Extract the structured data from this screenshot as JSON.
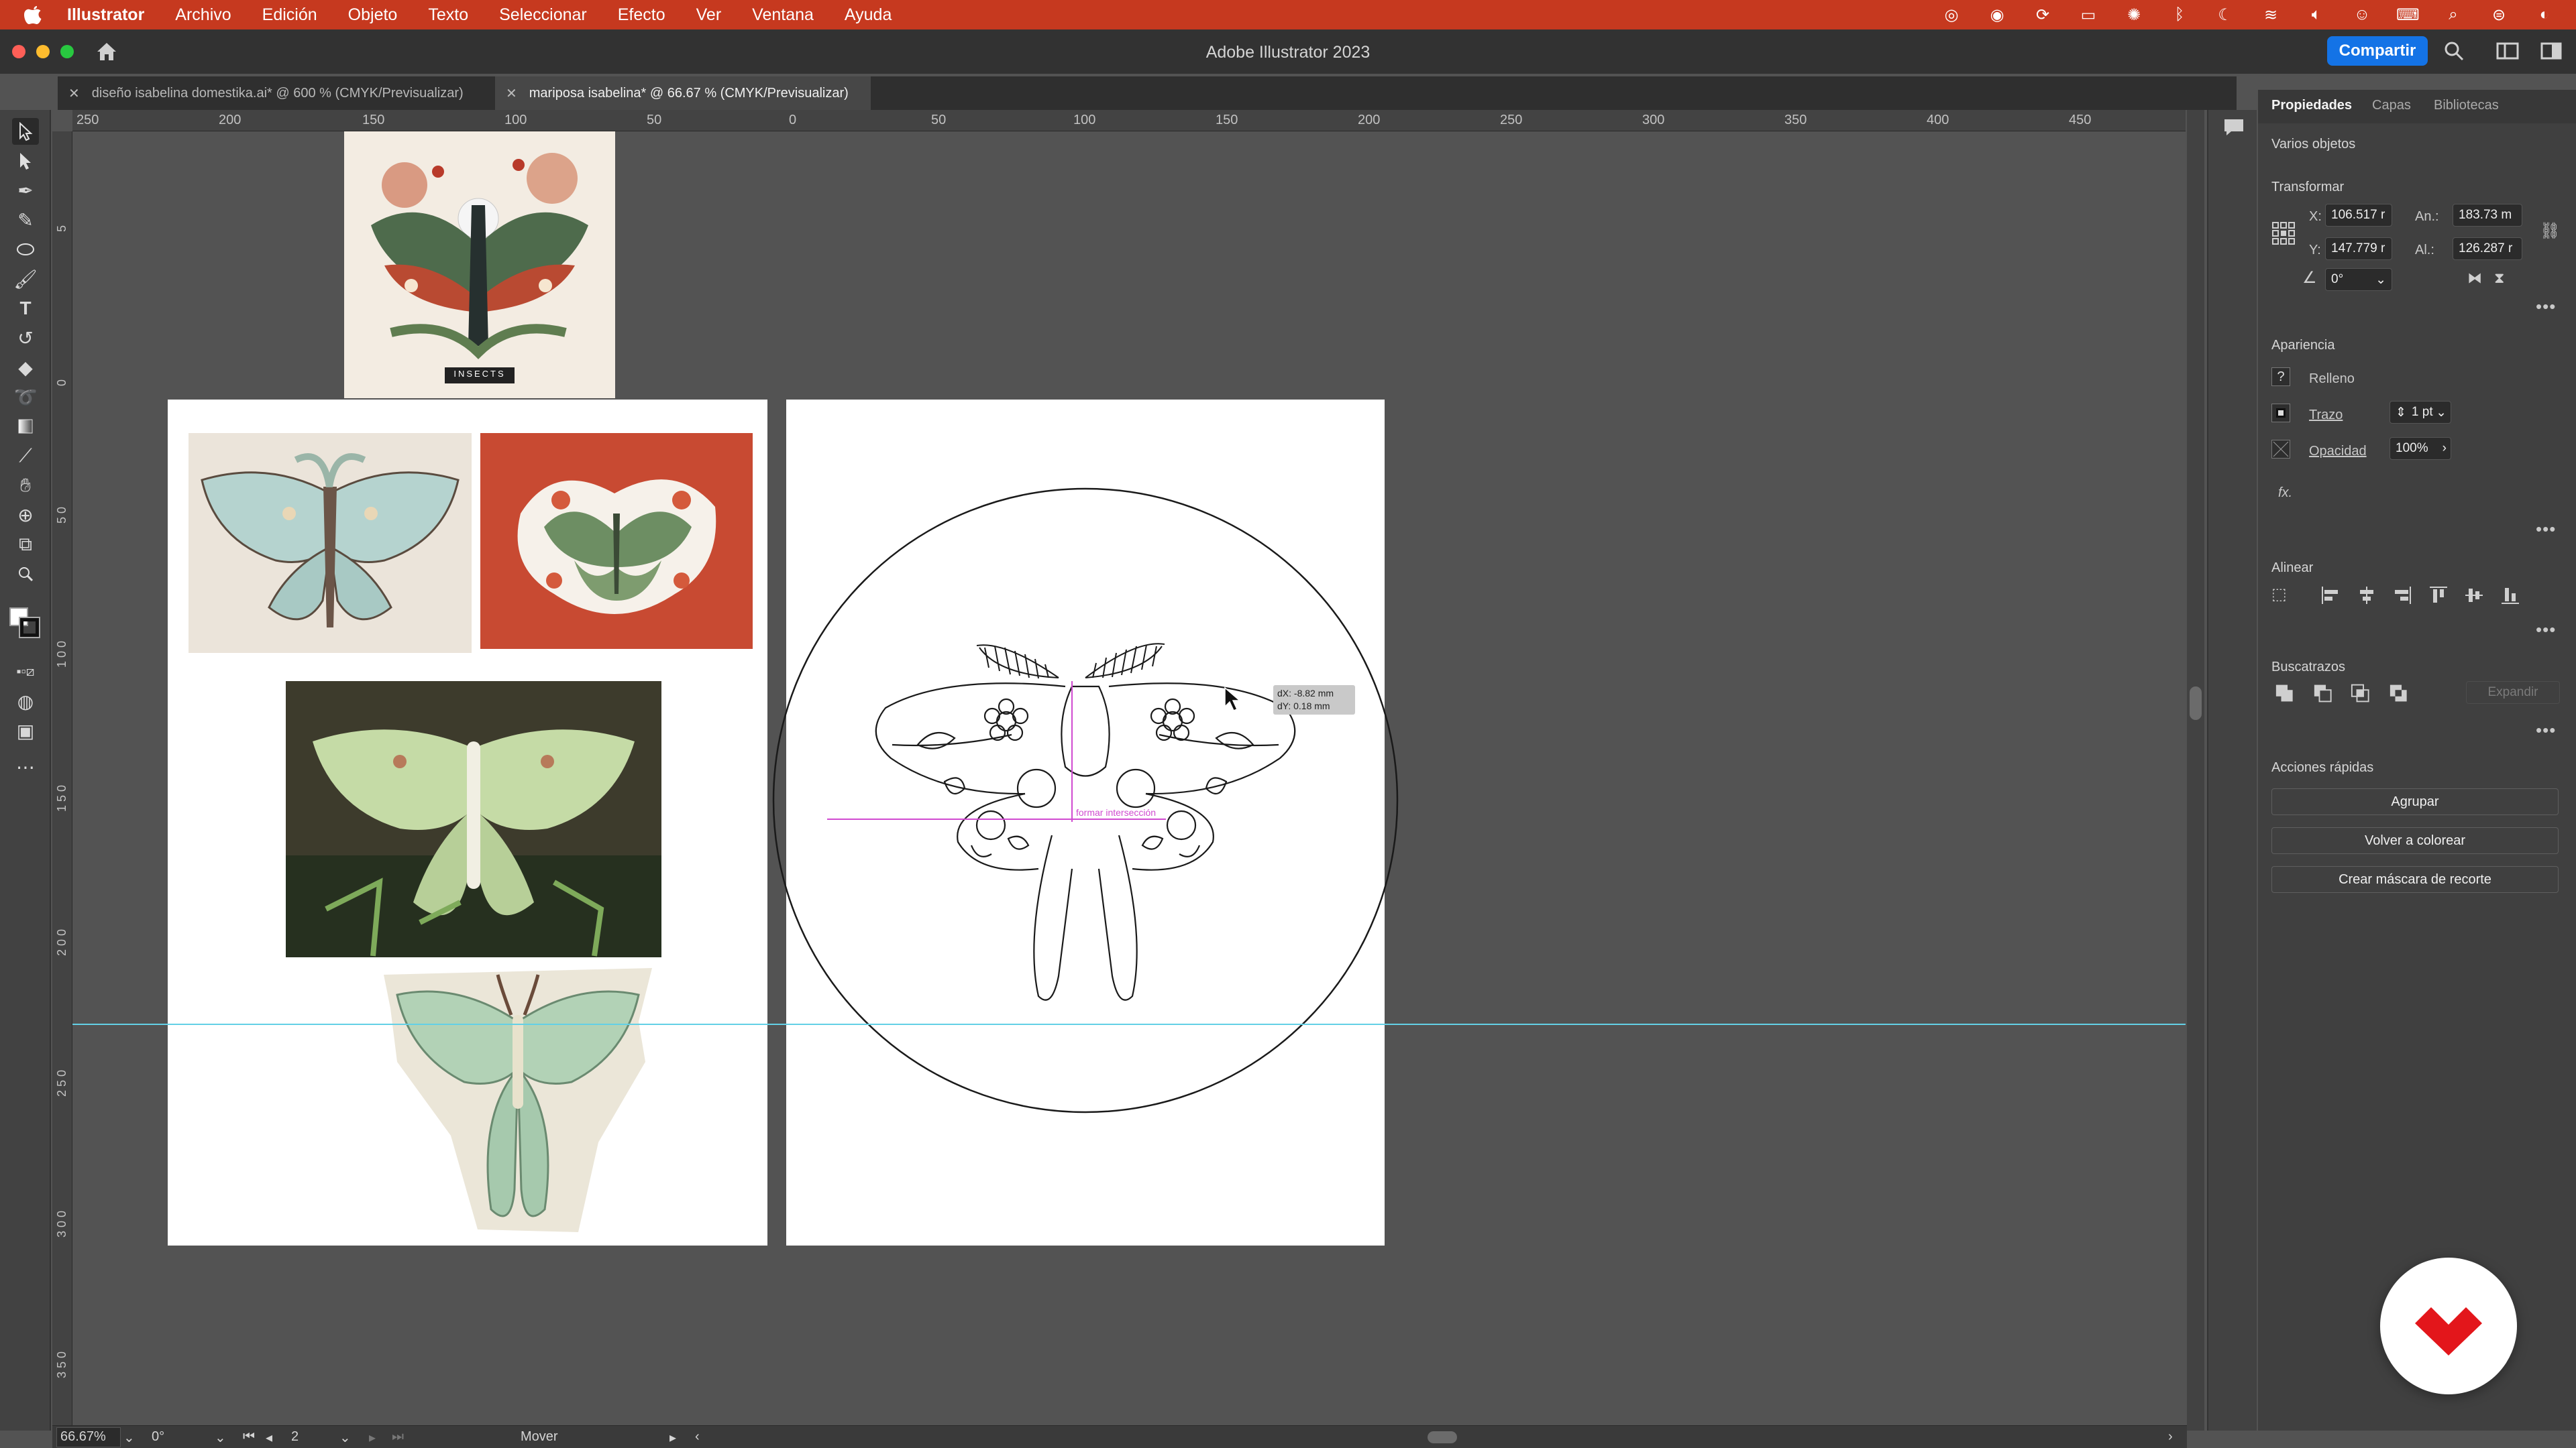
{
  "menubar": {
    "app_name": "Illustrator",
    "items": [
      "Archivo",
      "Edición",
      "Objeto",
      "Texto",
      "Seleccionar",
      "Efecto",
      "Ver",
      "Ventana",
      "Ayuda"
    ],
    "status_icons": [
      "creative-cloud-icon",
      "record-icon",
      "sync-icon",
      "display-icon",
      "color-wheel-icon",
      "bluetooth-icon",
      "night-mode-icon",
      "wifi-icon",
      "volume-icon",
      "user-icon",
      "keyboard-icon",
      "spotlight-icon",
      "control-center-icon",
      "siri-icon"
    ]
  },
  "titlebar": {
    "title": "Adobe Illustrator 2023",
    "share_label": "Compartir"
  },
  "tabs": [
    {
      "label": "diseño isabelina domestika.ai* @ 600 % (CMYK/Previsualizar)",
      "active": false
    },
    {
      "label": "mariposa isabelina* @ 66.67 % (CMYK/Previsualizar)",
      "active": true
    }
  ],
  "ruler": {
    "top_ticks": [
      "250",
      "200",
      "150",
      "100",
      "50",
      "0",
      "50",
      "100",
      "150",
      "200",
      "250",
      "300",
      "350",
      "400",
      "450"
    ],
    "left_ticks": [
      "5",
      "0",
      "5 0",
      "1 0 0",
      "1 5 0",
      "2 0 0",
      "2 5 0",
      "3 0 0",
      "3 5 0"
    ]
  },
  "canvas": {
    "reference_label": "INSECTS",
    "tooltip_dx": "dX: -8.82 mm",
    "tooltip_dy": "dY: 0.18 mm",
    "smart_guide": "formar intersección"
  },
  "properties": {
    "tabs": [
      "Propiedades",
      "Capas",
      "Bibliotecas"
    ],
    "selection": "Varios objetos",
    "transform": {
      "heading": "Transformar",
      "x_label": "X:",
      "x_value": "106.517 r",
      "y_label": "Y:",
      "y_value": "147.779 r",
      "w_label": "An.:",
      "w_value": "183.73 m",
      "h_label": "Al.:",
      "h_value": "126.287 r",
      "angle_value": "0°"
    },
    "appearance": {
      "heading": "Apariencia",
      "fill_label": "Relleno",
      "stroke_label": "Trazo",
      "stroke_value": "1 pt",
      "opacity_label": "Opacidad",
      "opacity_value": "100%",
      "fx_label": "fx."
    },
    "align": {
      "heading": "Alinear"
    },
    "pathfinder": {
      "heading": "Buscatrazos",
      "expand_label": "Expandir"
    },
    "quick_actions": {
      "heading": "Acciones rápidas",
      "group_label": "Agrupar",
      "recolor_label": "Volver a colorear",
      "clip_label": "Crear máscara de recorte"
    }
  },
  "statusbar": {
    "zoom": "66.67%",
    "rotation": "0°",
    "artboard": "2",
    "tool": "Mover"
  },
  "colors": {
    "menubar": "#c6391f",
    "accent": "#1473e6",
    "guide": "#63d0e6",
    "smart_guide": "#d04ad0",
    "domestika": "#e3161b"
  }
}
